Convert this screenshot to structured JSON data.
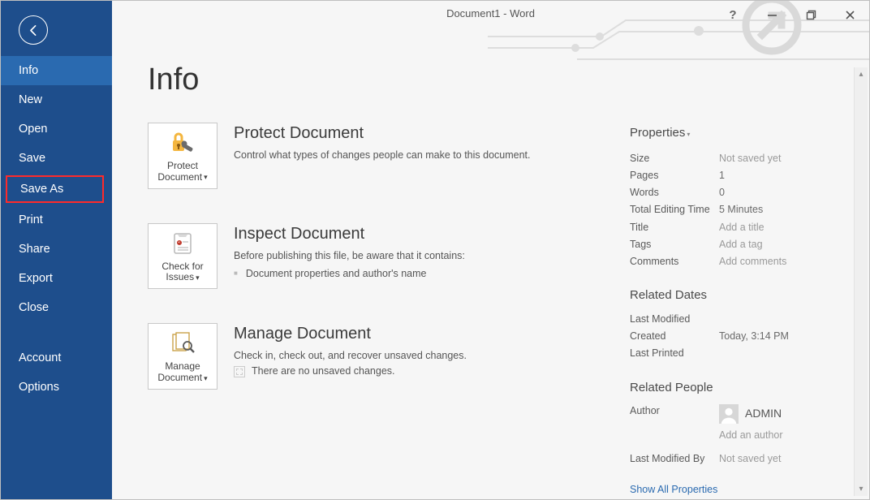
{
  "window_title": "Document1 - Word",
  "sidebar": {
    "items": [
      {
        "label": "Info",
        "selected": true,
        "highlight": false
      },
      {
        "label": "New",
        "selected": false,
        "highlight": false
      },
      {
        "label": "Open",
        "selected": false,
        "highlight": false
      },
      {
        "label": "Save",
        "selected": false,
        "highlight": false
      },
      {
        "label": "Save As",
        "selected": false,
        "highlight": true
      },
      {
        "label": "Print",
        "selected": false,
        "highlight": false
      },
      {
        "label": "Share",
        "selected": false,
        "highlight": false
      },
      {
        "label": "Export",
        "selected": false,
        "highlight": false
      },
      {
        "label": "Close",
        "selected": false,
        "highlight": false
      }
    ],
    "footer": [
      {
        "label": "Account"
      },
      {
        "label": "Options"
      }
    ]
  },
  "page": {
    "title": "Info",
    "sections": {
      "protect": {
        "button": "Protect Document",
        "title": "Protect Document",
        "desc": "Control what types of changes people can make to this document."
      },
      "inspect": {
        "button": "Check for Issues",
        "title": "Inspect Document",
        "desc": "Before publishing this file, be aware that it contains:",
        "bullet": "Document properties and author's name"
      },
      "manage": {
        "button": "Manage Document",
        "title": "Manage Document",
        "desc": "Check in, check out, and recover unsaved changes.",
        "note": "There are no unsaved changes."
      }
    }
  },
  "properties": {
    "header": "Properties",
    "rows": {
      "size": {
        "label": "Size",
        "value": "Not saved yet",
        "placeholder": false
      },
      "pages": {
        "label": "Pages",
        "value": "1",
        "placeholder": false
      },
      "words": {
        "label": "Words",
        "value": "0",
        "placeholder": false
      },
      "editing": {
        "label": "Total Editing Time",
        "value": "5 Minutes",
        "placeholder": false
      },
      "title": {
        "label": "Title",
        "value": "Add a title",
        "placeholder": true
      },
      "tags": {
        "label": "Tags",
        "value": "Add a tag",
        "placeholder": true
      },
      "comments": {
        "label": "Comments",
        "value": "Add comments",
        "placeholder": true
      }
    },
    "related_dates": {
      "title": "Related Dates",
      "last_modified": {
        "label": "Last Modified",
        "value": ""
      },
      "created": {
        "label": "Created",
        "value": "Today, 3:14 PM"
      },
      "last_printed": {
        "label": "Last Printed",
        "value": ""
      }
    },
    "related_people": {
      "title": "Related People",
      "author_label": "Author",
      "author_name": "ADMIN",
      "add_author": "Add an author",
      "last_modified_by": {
        "label": "Last Modified By",
        "value": "Not saved yet"
      }
    },
    "show_all": "Show All Properties"
  }
}
